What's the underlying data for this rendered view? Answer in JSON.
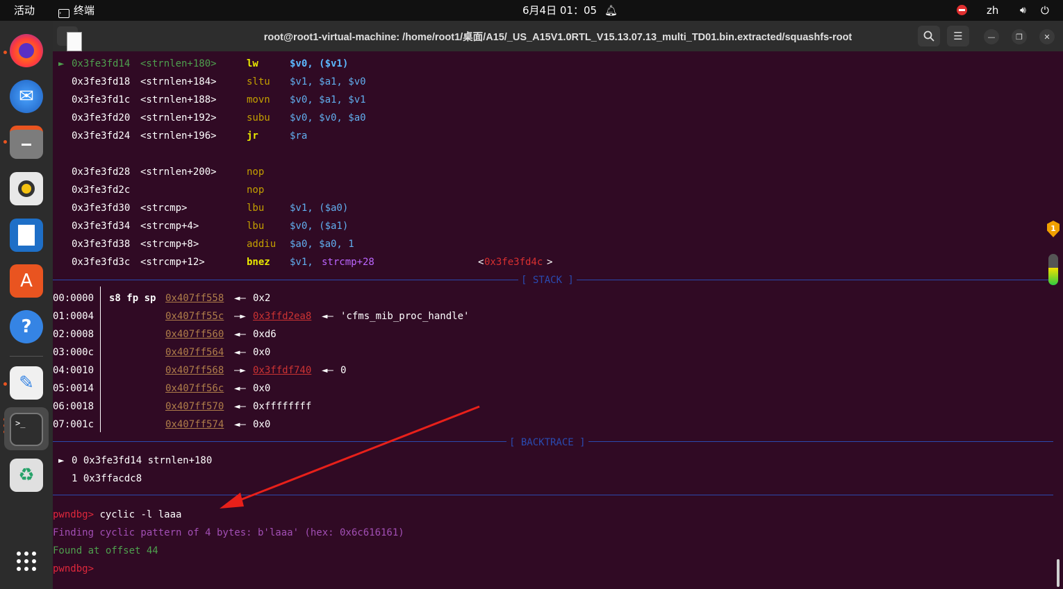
{
  "topbar": {
    "activities": "活动",
    "app_name": "终端",
    "clock": "6月4日  01：05",
    "lang": "zh"
  },
  "window": {
    "title": "root@root1-virtual-machine: /home/root1/桌面/A15/_US_A15V1.0RTL_V15.13.07.13_multi_TD01.bin.extracted/squashfs-root"
  },
  "disasm": [
    {
      "marker": "►",
      "addr": "0x3fe3fd14",
      "sym": "<strnlen+180>",
      "mn": "lw",
      "ops": "$v0, ($v1)",
      "cur": true
    },
    {
      "marker": "",
      "addr": "0x3fe3fd18",
      "sym": "<strnlen+184>",
      "mn": "sltu",
      "ops": "$v1, $a1, $v0",
      "cur": false
    },
    {
      "marker": "",
      "addr": "0x3fe3fd1c",
      "sym": "<strnlen+188>",
      "mn": "movn",
      "ops": "$v0, $a1, $v1",
      "cur": false
    },
    {
      "marker": "",
      "addr": "0x3fe3fd20",
      "sym": "<strnlen+192>",
      "mn": "subu",
      "ops": "$v0, $v0, $a0",
      "cur": false
    },
    {
      "marker": "",
      "addr": "0x3fe3fd24",
      "sym": "<strnlen+196>",
      "mn": "jr",
      "ops": "$ra",
      "cur": false,
      "bold": true
    },
    {
      "marker": "",
      "addr": "0x3fe3fd28",
      "sym": "<strnlen+200>",
      "mn": "nop",
      "ops": "",
      "cur": false
    },
    {
      "marker": "",
      "addr": "0x3fe3fd2c",
      "sym": "",
      "mn": "nop",
      "ops": "",
      "cur": false
    },
    {
      "marker": "",
      "addr": "0x3fe3fd30",
      "sym": "<strcmp>",
      "mn": "lbu",
      "ops": "$v1, ($a0)",
      "cur": false
    },
    {
      "marker": "",
      "addr": "0x3fe3fd34",
      "sym": "<strcmp+4>",
      "mn": "lbu",
      "ops": "$v0, ($a1)",
      "cur": false
    },
    {
      "marker": "",
      "addr": "0x3fe3fd38",
      "sym": "<strcmp+8>",
      "mn": "addiu",
      "ops": "$a0, $a0, 1",
      "cur": false
    },
    {
      "marker": "",
      "addr": "0x3fe3fd3c",
      "sym": "<strcmp+12>",
      "mn": "bnez",
      "ops": "$v1, ",
      "target": "strcmp+28",
      "comment_pre": "<",
      "comment": "0x3fe3fd4c",
      "comment_post": ">",
      "cur": false,
      "bold": true
    }
  ],
  "stack_label": "[ STACK ]",
  "stack": [
    {
      "idx": "00:0000",
      "regs": "s8 fp sp",
      "addr": "0x407ff558",
      "arrow": "◄—",
      "val": "0x2"
    },
    {
      "idx": "01:0004",
      "regs": "",
      "addr": "0x407ff55c",
      "arrow": "—►",
      "val": "0x3ffd2ea8",
      "arrow2": "◄—",
      "val2": "'cfms_mib_proc_handle'"
    },
    {
      "idx": "02:0008",
      "regs": "",
      "addr": "0x407ff560",
      "arrow": "◄—",
      "val": "0xd6"
    },
    {
      "idx": "03:000c",
      "regs": "",
      "addr": "0x407ff564",
      "arrow": "◄—",
      "val": "0x0"
    },
    {
      "idx": "04:0010",
      "regs": "",
      "addr": "0x407ff568",
      "arrow": "—►",
      "val": "0x3ffdf740",
      "arrow2": "◄—",
      "val2": "0"
    },
    {
      "idx": "05:0014",
      "regs": "",
      "addr": "0x407ff56c",
      "arrow": "◄—",
      "val": "0x0"
    },
    {
      "idx": "06:0018",
      "regs": "",
      "addr": "0x407ff570",
      "arrow": "◄—",
      "val": "0xffffffff"
    },
    {
      "idx": "07:001c",
      "regs": "",
      "addr": "0x407ff574",
      "arrow": "◄—",
      "val": "0x0"
    }
  ],
  "backtrace_label": "[ BACKTRACE ]",
  "backtrace": [
    {
      "marker": "►",
      "text": "0 0x3fe3fd14 strnlen+180"
    },
    {
      "marker": "",
      "text": "1 0x3ffacdc8"
    }
  ],
  "console": {
    "prompt": "pwndbg>",
    "command": " cyclic -l laaa",
    "finding": "Finding cyclic pattern of 4 bytes: b'laaa' (hex: 0x6c616161)",
    "found": "Found at offset 44",
    "prompt2": "pwndbg>"
  },
  "colors": {
    "terminal_bg": "#300a24",
    "prompt": "#e0283c",
    "accent": "#e95420"
  },
  "dock_icons": [
    "firefox-icon",
    "thunderbird-icon",
    "files-icon",
    "rhythmbox-icon",
    "writer-icon",
    "software-icon",
    "help-icon",
    "text-editor-icon",
    "terminal-icon",
    "trash-icon",
    "app-grid-icon"
  ]
}
